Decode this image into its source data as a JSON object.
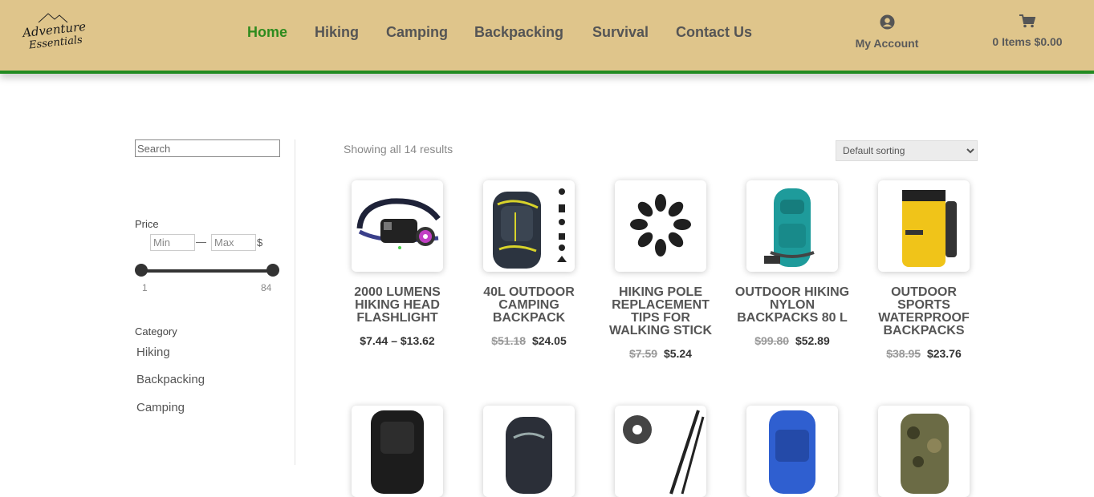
{
  "logo": {
    "line1": "Adventure",
    "line2": "Essentials"
  },
  "nav": [
    {
      "label": "Home",
      "active": true
    },
    {
      "label": "Hiking"
    },
    {
      "label": "Camping"
    },
    {
      "label": "Backpacking"
    },
    {
      "label": "Survival"
    },
    {
      "label": "Contact Us"
    }
  ],
  "account": {
    "label": "My Account",
    "icon": "user-circle-icon"
  },
  "cart": {
    "label": "0 Items $0.00",
    "icon": "shopping-cart-icon"
  },
  "colors": {
    "header_bg": "#dfc58b",
    "accent": "#228b22",
    "active_nav": "#2e8b1e"
  },
  "sidebar": {
    "search_placeholder": "Search",
    "price_title": "Price",
    "min_placeholder": "Min",
    "max_placeholder": "Max",
    "dash": "—",
    "currency": "$",
    "range_min": "1",
    "range_max": "84",
    "category_title": "Category",
    "categories": [
      "Hiking",
      "Backpacking",
      "Camping"
    ]
  },
  "main": {
    "result_count": "Showing all 14 results",
    "sort_selected": "Default sorting",
    "products": [
      {
        "title": "2000 LUMENS HIKING HEAD FLASHLIGHT",
        "old_price": "",
        "price": "$7.44 – $13.62",
        "image": "headlamp"
      },
      {
        "title": "40L OUTDOOR CAMPING BACKPACK",
        "old_price": "$51.18",
        "price": "$24.05",
        "image": "backpack-dark"
      },
      {
        "title": "HIKING POLE REPLACEMENT TIPS FOR WALKING STICK",
        "old_price": "$7.59",
        "price": "$5.24",
        "image": "pole-tips"
      },
      {
        "title": "OUTDOOR HIKING NYLON BACKPACKS 80 L",
        "old_price": "$99.80",
        "price": "$52.89",
        "image": "backpack-teal"
      },
      {
        "title": "OUTDOOR SPORTS WATERPROOF BACKPACKS",
        "old_price": "$38.95",
        "price": "$23.76",
        "image": "drybag-yellow"
      },
      {
        "title": "",
        "old_price": "",
        "price": "",
        "image": "backpack-black"
      },
      {
        "title": "",
        "old_price": "",
        "price": "",
        "image": "backpack-grey"
      },
      {
        "title": "",
        "old_price": "",
        "price": "",
        "image": "pole-baskets"
      },
      {
        "title": "",
        "old_price": "",
        "price": "",
        "image": "backpack-blue"
      },
      {
        "title": "",
        "old_price": "",
        "price": "",
        "image": "backpack-camo"
      }
    ]
  }
}
